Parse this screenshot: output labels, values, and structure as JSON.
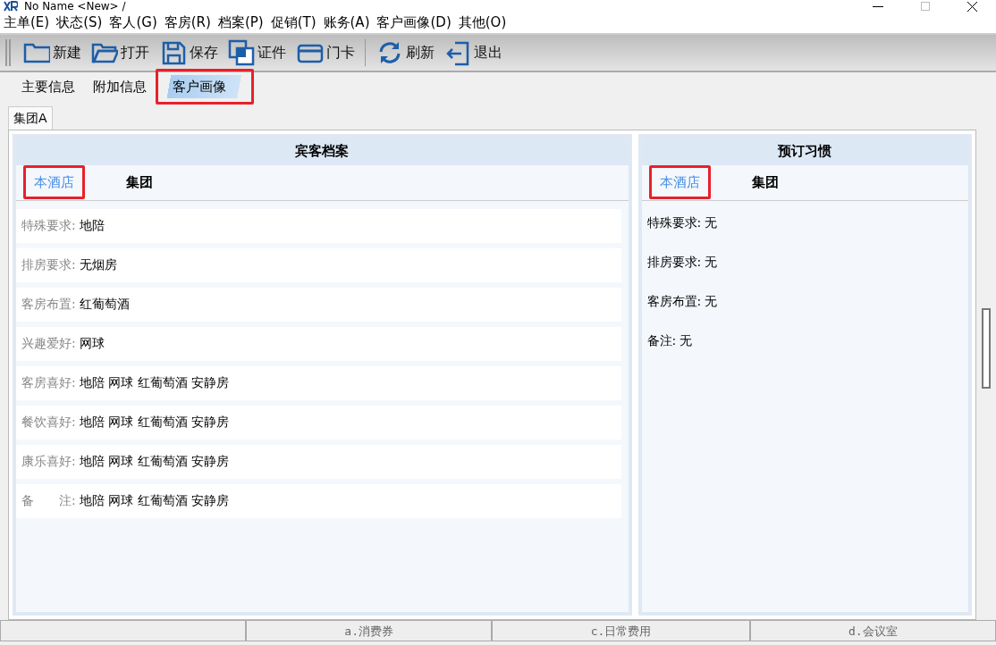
{
  "window": {
    "title": "No Name <New> /"
  },
  "menu": [
    "主单(E)",
    "状态(S)",
    "客人(G)",
    "客房(R)",
    "档案(P)",
    "促销(T)",
    "账务(A)",
    "客户画像(D)",
    "其他(O)"
  ],
  "toolbar": [
    {
      "kind": "folder",
      "label": "新建"
    },
    {
      "kind": "open",
      "label": "打开"
    },
    {
      "kind": "save",
      "label": "保存"
    },
    {
      "kind": "cards",
      "label": "证件"
    },
    {
      "kind": "card",
      "label": "门卡"
    },
    {
      "kind": "refresh",
      "label": "刷新"
    },
    {
      "kind": "exit",
      "label": "退出"
    }
  ],
  "tabs": [
    {
      "label": "主要信息",
      "selected": false,
      "highlighted": false
    },
    {
      "label": "附加信息",
      "selected": false,
      "highlighted": false
    },
    {
      "label": "客户画像",
      "selected": true,
      "highlighted": true
    }
  ],
  "group_tab": {
    "label": "集团A"
  },
  "panels": [
    {
      "title": "宾客档案",
      "kind": "cards",
      "subtabs": [
        {
          "label": "本酒店",
          "selected": true,
          "highlighted": true
        },
        {
          "label": "集团",
          "selected": false,
          "highlighted": false
        }
      ],
      "rows": [
        {
          "label": "特殊要求:",
          "value": "地陪"
        },
        {
          "label": "排房要求:",
          "value": "无烟房"
        },
        {
          "label": "客房布置:",
          "value": "红葡萄酒"
        },
        {
          "label": "兴趣爱好:",
          "value": "网球"
        },
        {
          "label": "客房喜好:",
          "value": "地陪 网球 红葡萄酒 安静房"
        },
        {
          "label": "餐饮喜好:",
          "value": "地陪 网球 红葡萄酒 安静房"
        },
        {
          "label": "康乐喜好:",
          "value": "地陪 网球 红葡萄酒 安静房"
        },
        {
          "label": "备　　注:",
          "value": "地陪 网球 红葡萄酒 安静房"
        }
      ]
    },
    {
      "title": "预订习惯",
      "kind": "plain",
      "subtabs": [
        {
          "label": "本酒店",
          "selected": true,
          "highlighted": true
        },
        {
          "label": "集团",
          "selected": false,
          "highlighted": false
        }
      ],
      "rows": [
        {
          "label": "特殊要求:",
          "value": "无"
        },
        {
          "label": "排房要求:",
          "value": "无"
        },
        {
          "label": "客房布置:",
          "value": "无"
        },
        {
          "label": "备注:",
          "value": "无"
        }
      ]
    }
  ],
  "bottom_tabs": [
    "a.消费券",
    "c.日常费用",
    "d.会议室"
  ]
}
